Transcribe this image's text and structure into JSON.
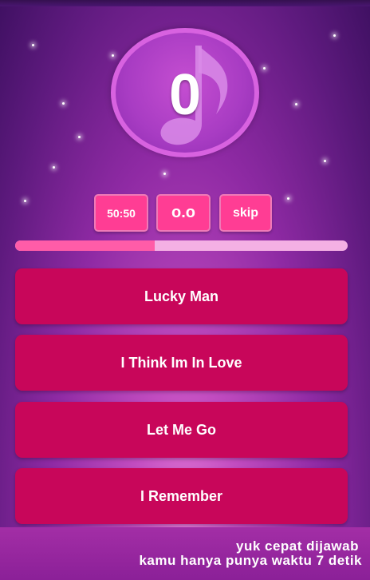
{
  "score": {
    "value": "0",
    "icon": "music-note-icon"
  },
  "lifelines": {
    "fifty_fifty": "50:50",
    "oo": "o.o",
    "skip": "skip"
  },
  "timer": {
    "progress": 0.42,
    "fill_color": "#ff5ca8",
    "track_color": "#f4b0e4"
  },
  "answers": [
    {
      "label": "Lucky Man"
    },
    {
      "label": "I Think Im In Love"
    },
    {
      "label": "Let Me Go"
    },
    {
      "label": "I Remember"
    }
  ],
  "footer": {
    "line1": "yuk cepat dijawab",
    "line2": "kamu hanya punya waktu 7 detik"
  },
  "colors": {
    "answer_bg": "#c8065a",
    "lifeline_bg": "#ff3d94",
    "badge": "#a83cc3"
  }
}
